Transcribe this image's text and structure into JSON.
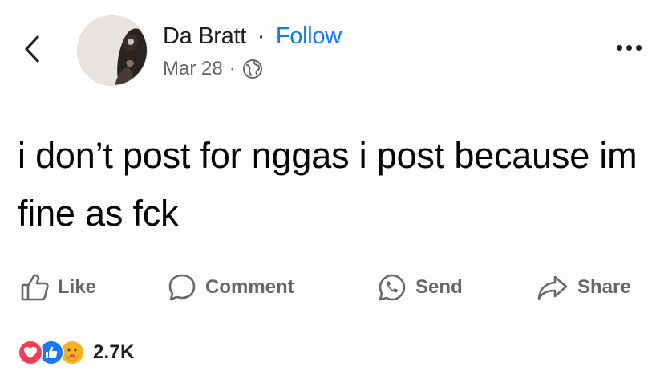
{
  "header": {
    "author_name": "Da Bratt",
    "separator": "·",
    "follow_label": "Follow",
    "date": "Mar 28",
    "meta_separator": "·",
    "privacy_icon": "globe-icon",
    "back_icon": "chevron-left-icon",
    "more_icon": "more-horizontal-icon"
  },
  "post": {
    "text": "i don’t post for nggas i post because im fine as fck"
  },
  "actions": {
    "like_label": "Like",
    "comment_label": "Comment",
    "send_label": "Send",
    "share_label": "Share"
  },
  "reactions": {
    "types": [
      "love-icon",
      "like-icon",
      "care-icon"
    ],
    "count": "2.7K"
  },
  "colors": {
    "accent": "#1877f2",
    "muted": "#65676b",
    "love": "#f33e58",
    "care": "#f7b125"
  }
}
